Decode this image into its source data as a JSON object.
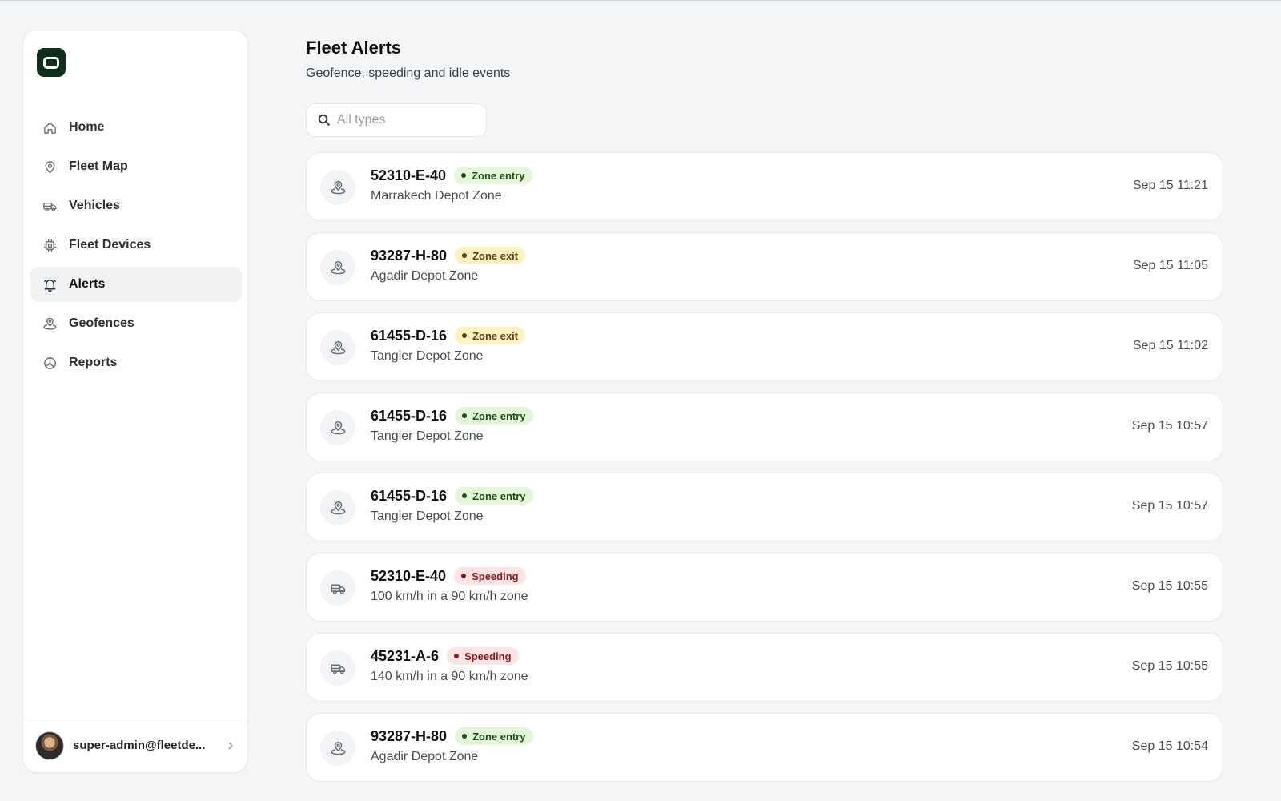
{
  "nav": {
    "items": [
      {
        "label": "Home",
        "icon": "home-icon",
        "active": false
      },
      {
        "label": "Fleet Map",
        "icon": "map-pin-icon",
        "active": false
      },
      {
        "label": "Vehicles",
        "icon": "truck-icon",
        "active": false
      },
      {
        "label": "Fleet Devices",
        "icon": "chip-icon",
        "active": false
      },
      {
        "label": "Alerts",
        "icon": "bell-icon",
        "active": true
      },
      {
        "label": "Geofences",
        "icon": "geofence-icon",
        "active": false
      },
      {
        "label": "Reports",
        "icon": "pie-chart-icon",
        "active": false
      }
    ]
  },
  "user": {
    "email": "super-admin@fleetde..."
  },
  "header": {
    "title": "Fleet Alerts",
    "subtitle": "Geofence, speeding and idle events"
  },
  "search": {
    "placeholder": "All types",
    "value": ""
  },
  "alerts": [
    {
      "plate": "52310-E-40",
      "type": "Zone entry",
      "kind": "entry",
      "icon": "geofence-icon",
      "desc": "Marrakech Depot Zone",
      "time": "Sep 15 11:21"
    },
    {
      "plate": "93287-H-80",
      "type": "Zone exit",
      "kind": "exit",
      "icon": "geofence-icon",
      "desc": "Agadir Depot Zone",
      "time": "Sep 15 11:05"
    },
    {
      "plate": "61455-D-16",
      "type": "Zone exit",
      "kind": "exit",
      "icon": "geofence-icon",
      "desc": "Tangier Depot Zone",
      "time": "Sep 15 11:02"
    },
    {
      "plate": "61455-D-16",
      "type": "Zone entry",
      "kind": "entry",
      "icon": "geofence-icon",
      "desc": "Tangier Depot Zone",
      "time": "Sep 15 10:57"
    },
    {
      "plate": "61455-D-16",
      "type": "Zone entry",
      "kind": "entry",
      "icon": "geofence-icon",
      "desc": "Tangier Depot Zone",
      "time": "Sep 15 10:57"
    },
    {
      "plate": "52310-E-40",
      "type": "Speeding",
      "kind": "speed",
      "icon": "truck-icon",
      "desc": "100 km/h in a 90 km/h zone",
      "time": "Sep 15 10:55"
    },
    {
      "plate": "45231-A-6",
      "type": "Speeding",
      "kind": "speed",
      "icon": "truck-icon",
      "desc": "140 km/h in a 90 km/h zone",
      "time": "Sep 15 10:55"
    },
    {
      "plate": "93287-H-80",
      "type": "Zone entry",
      "kind": "entry",
      "icon": "geofence-icon",
      "desc": "Agadir Depot Zone",
      "time": "Sep 15 10:54"
    }
  ]
}
